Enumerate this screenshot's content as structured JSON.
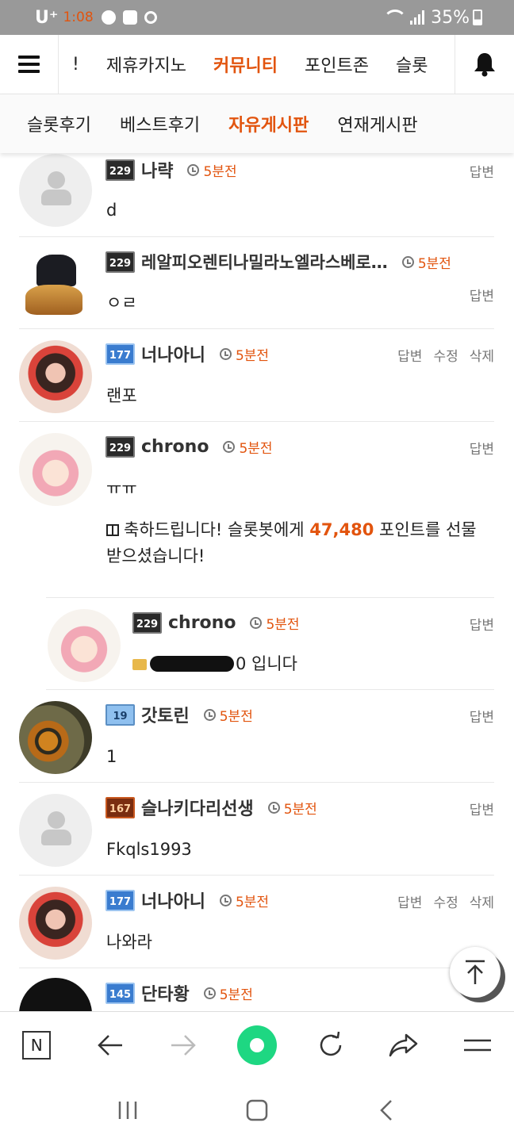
{
  "status_bar": {
    "carrier": "U⁺",
    "time": "1:08",
    "battery": "35%"
  },
  "top_nav": {
    "tabs": [
      {
        "label": "!"
      },
      {
        "label": "제휴카지노"
      },
      {
        "label": "커뮤니티"
      },
      {
        "label": "포인트존"
      },
      {
        "label": "슬롯"
      }
    ],
    "active_tab": "커뮤니티"
  },
  "sub_nav": {
    "tabs": [
      {
        "label": "슬롯후기"
      },
      {
        "label": "베스트후기"
      },
      {
        "label": "자유게시판"
      },
      {
        "label": "연재게시판"
      }
    ],
    "active_tab": "자유게시판"
  },
  "actions": {
    "reply": "답변",
    "edit": "수정",
    "delete": "삭제"
  },
  "comments": [
    {
      "nick": "나략",
      "level": "229",
      "time": "5분전",
      "body": "d",
      "avatar": "default-avatar"
    },
    {
      "nick": "레알피오렌티나밀라노엘라스베로…",
      "level": "229",
      "time": "5분전",
      "body": "ㅇㄹ",
      "avatar": "vegeta-avatar"
    },
    {
      "nick": "너나아니",
      "level": "177",
      "time": "5분전",
      "body": "랜포",
      "avatar": "girl-avatar"
    },
    {
      "nick": "chrono",
      "level": "229",
      "time": "5분전",
      "body": "ㅠㅠ",
      "avatar": "anime-avatar",
      "gift": {
        "prefix": "축하드립니다! 슬롯봇에게 ",
        "points": "47,480",
        "suffix": " 포인트를 선물",
        "line2": "받으셨습니다!"
      }
    },
    {
      "nick": "chrono",
      "level": "229",
      "time": "5분전",
      "body_suffix": "0 입니다",
      "avatar": "anime-avatar"
    },
    {
      "nick": "갓토린",
      "level": "19",
      "time": "5분전",
      "body": "1",
      "avatar": "tiger-avatar"
    },
    {
      "nick": "슬나키다리선생",
      "level": "167",
      "time": "5분전",
      "body": "Fkqls1993",
      "avatar": "default-avatar"
    },
    {
      "nick": "너나아니",
      "level": "177",
      "time": "5분전",
      "body": "나와라",
      "avatar": "girl-avatar"
    },
    {
      "nick": "단타황",
      "level": "145",
      "time": "5분전",
      "body": "",
      "avatar": "dark-avatar"
    }
  ],
  "bottom_toolbar": {
    "n_label": "N",
    "icons": [
      "n-box-icon",
      "back-arrow-icon",
      "forward-arrow-icon",
      "home-circle-icon",
      "refresh-icon",
      "share-icon",
      "menu-icon"
    ]
  },
  "colors": {
    "accent": "#e2540e",
    "home_button": "#1ed782",
    "status_bar": "#999999"
  }
}
